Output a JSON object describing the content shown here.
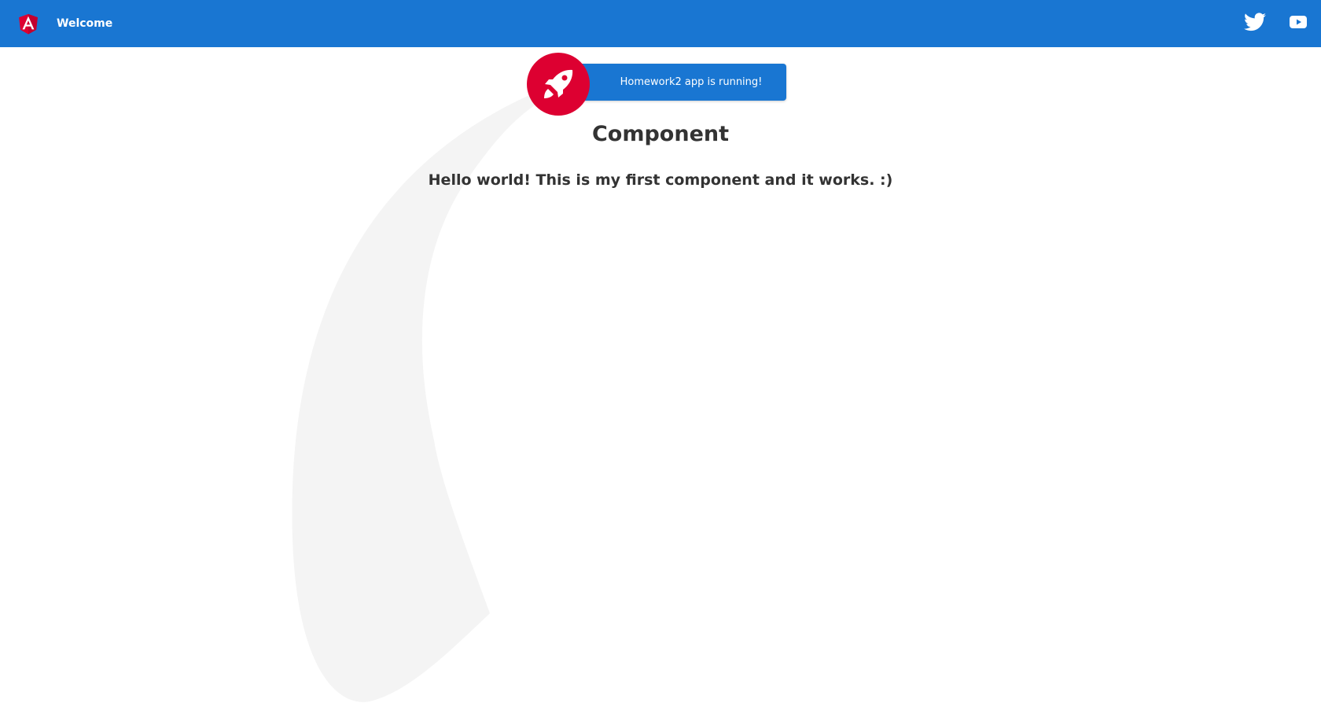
{
  "toolbar": {
    "welcome": "Welcome",
    "logo_icon": "angular-logo-icon",
    "twitter_icon": "twitter-icon",
    "youtube_icon": "youtube-icon"
  },
  "card": {
    "text": "Homework2 app is running!",
    "icon": "rocket-icon"
  },
  "main": {
    "heading": "Component",
    "message": "Hello world! This is my first component and it works. :)"
  },
  "colors": {
    "toolbar_bg": "#1976d2",
    "accent": "#dd0031",
    "swoosh": "#f4f4f4",
    "text": "#333333"
  }
}
